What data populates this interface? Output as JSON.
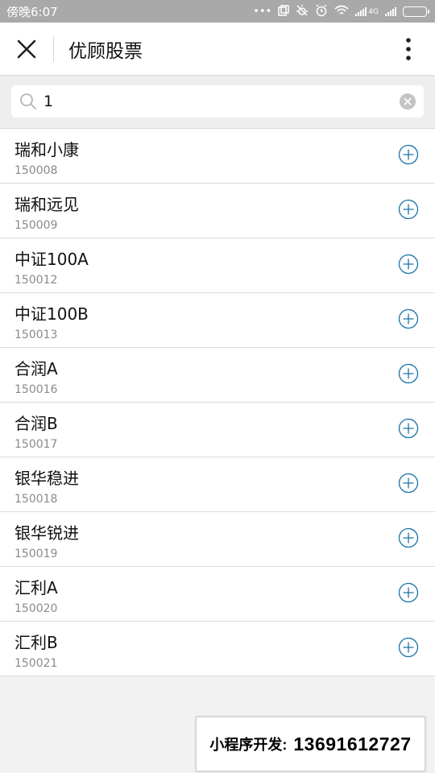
{
  "status_bar": {
    "time": "傍晚6:07",
    "icons": [
      "dots-icon",
      "copy-icon",
      "bug-icon",
      "alarm-icon",
      "wifi-icon",
      "signal-icon",
      "battery-icon"
    ],
    "network_label": "4G"
  },
  "header": {
    "title": "优顾股票",
    "close_icon": "close-icon",
    "more_icon": "more-vertical-icon"
  },
  "search": {
    "value": "1",
    "placeholder": ""
  },
  "stocks": [
    {
      "name": "瑞和小康",
      "code": "150008"
    },
    {
      "name": "瑞和远见",
      "code": "150009"
    },
    {
      "name": "中证100A",
      "code": "150012"
    },
    {
      "name": "中证100B",
      "code": "150013"
    },
    {
      "name": "合润A",
      "code": "150016"
    },
    {
      "name": "合润B",
      "code": "150017"
    },
    {
      "name": "银华稳进",
      "code": "150018"
    },
    {
      "name": "银华锐进",
      "code": "150019"
    },
    {
      "name": "汇利A",
      "code": "150020"
    },
    {
      "name": "汇利B",
      "code": "150021"
    }
  ],
  "promo": {
    "label": "小程序开发:",
    "phone": "13691612727"
  },
  "colors": {
    "accent": "#1a73a8",
    "status_bar": "#a9a9a9",
    "code_text": "#8a8a8a"
  }
}
